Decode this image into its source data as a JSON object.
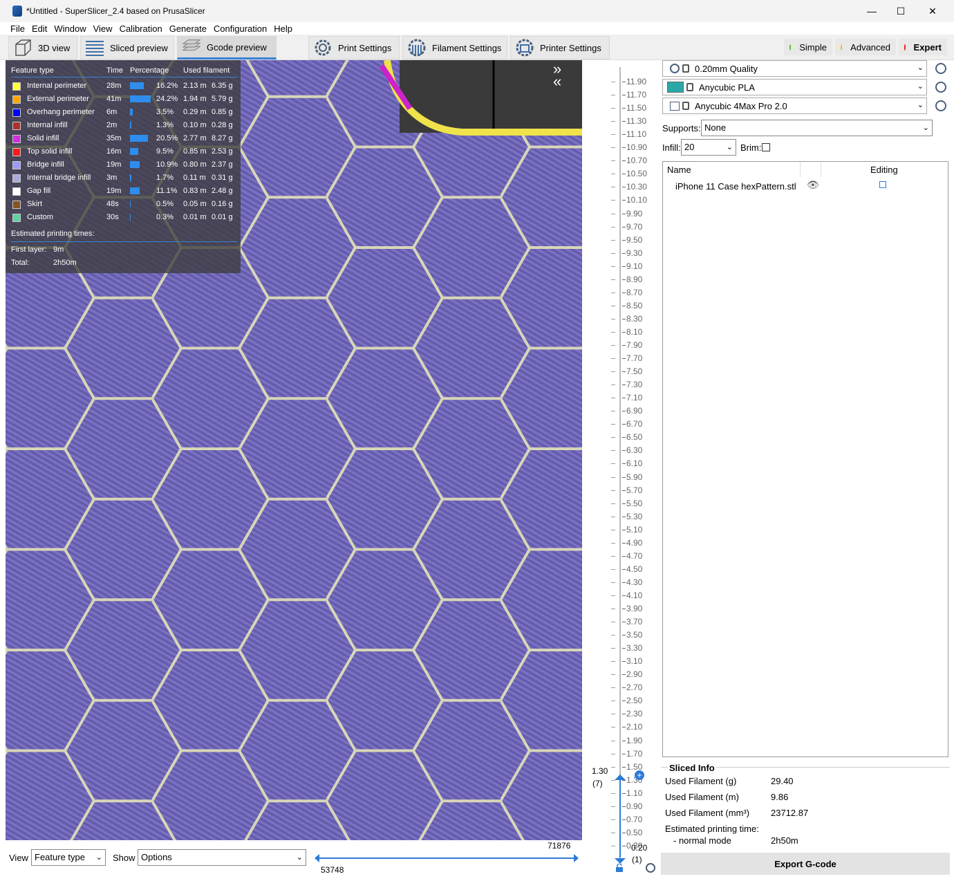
{
  "window": {
    "title": "*Untitled - SuperSlicer_2.4  based on PrusaSlicer"
  },
  "menu": [
    "File",
    "Edit",
    "Window",
    "View",
    "Calibration",
    "Generate",
    "Configuration",
    "Help"
  ],
  "tabs": {
    "view3d": "3D view",
    "sliced": "Sliced preview",
    "gcode": "Gcode preview",
    "print": "Print Settings",
    "filament": "Filament Settings",
    "printer": "Printer Settings"
  },
  "modes": {
    "simple": "Simple",
    "advanced": "Advanced",
    "expert": "Expert"
  },
  "mode_colors": {
    "simple": "#4ec42a",
    "advanced": "#f2c200",
    "expert": "#e02020"
  },
  "legend": {
    "headers": {
      "feature": "Feature type",
      "time": "Time",
      "pct": "Percentage",
      "used": "Used filament"
    },
    "rows": [
      {
        "name": "Internal perimeter",
        "color": "#ffff40",
        "time": "28m",
        "pct": "16.2%",
        "m": "2.13 m",
        "g": "6.35 g",
        "frac": 0.162
      },
      {
        "name": "External perimeter",
        "color": "#ffa500",
        "time": "41m",
        "pct": "24.2%",
        "m": "1.94 m",
        "g": "5.79 g",
        "frac": 0.242
      },
      {
        "name": "Overhang perimeter",
        "color": "#0000ff",
        "time": "6m",
        "pct": "3.5%",
        "m": "0.29 m",
        "g": "0.85 g",
        "frac": 0.035
      },
      {
        "name": "Internal infill",
        "color": "#b03029",
        "time": "2m",
        "pct": "1.3%",
        "m": "0.10 m",
        "g": "0.28 g",
        "frac": 0.013
      },
      {
        "name": "Solid infill",
        "color": "#d22de0",
        "time": "35m",
        "pct": "20.5%",
        "m": "2.77 m",
        "g": "8.27 g",
        "frac": 0.205
      },
      {
        "name": "Top solid infill",
        "color": "#ff1a1a",
        "time": "16m",
        "pct": "9.5%",
        "m": "0.85 m",
        "g": "2.53 g",
        "frac": 0.095
      },
      {
        "name": "Bridge infill",
        "color": "#9999ff",
        "time": "19m",
        "pct": "10.9%",
        "m": "0.80 m",
        "g": "2.37 g",
        "frac": 0.109
      },
      {
        "name": "Internal bridge infill",
        "color": "#aaaadd",
        "time": "3m",
        "pct": "1.7%",
        "m": "0.11 m",
        "g": "0.31 g",
        "frac": 0.017
      },
      {
        "name": "Gap fill",
        "color": "#ffffff",
        "time": "19m",
        "pct": "11.1%",
        "m": "0.83 m",
        "g": "2.48 g",
        "frac": 0.111
      },
      {
        "name": "Skirt",
        "color": "#845321",
        "time": "48s",
        "pct": "0.5%",
        "m": "0.05 m",
        "g": "0.16 g",
        "frac": 0.005
      },
      {
        "name": "Custom",
        "color": "#5ad3a0",
        "time": "30s",
        "pct": "0.3%",
        "m": "0.01 m",
        "g": "0.01 g",
        "frac": 0.003
      }
    ],
    "est_label": "Estimated printing times:",
    "first_layer_label": "First layer:",
    "first_layer": "9m",
    "total_label": "Total:",
    "total": "2h50m"
  },
  "ruler": {
    "labels": [
      "11.90",
      "11.70",
      "11.50",
      "11.30",
      "11.10",
      "10.90",
      "10.70",
      "10.50",
      "10.30",
      "10.10",
      "9.90",
      "9.70",
      "9.50",
      "9.30",
      "9.10",
      "8.90",
      "8.70",
      "8.50",
      "8.30",
      "8.10",
      "7.90",
      "7.70",
      "7.50",
      "7.30",
      "7.10",
      "6.90",
      "6.70",
      "6.50",
      "6.30",
      "6.10",
      "5.90",
      "5.70",
      "5.50",
      "5.30",
      "5.10",
      "4.90",
      "4.70",
      "4.50",
      "4.30",
      "4.10",
      "3.90",
      "3.70",
      "3.50",
      "3.30",
      "3.10",
      "2.90",
      "2.70",
      "2.50",
      "2.30",
      "2.10",
      "1.90",
      "1.70",
      "1.50",
      "1.30",
      "1.10",
      "0.90",
      "0.70",
      "0.50",
      "0.30"
    ],
    "upper_value": "1.30",
    "upper_layer": "(7)",
    "lower_value": "0.20",
    "lower_layer": "(1)"
  },
  "bottom": {
    "view_label": "View",
    "view_value": "Feature type",
    "show_label": "Show",
    "show_value": "Options",
    "h_right": "71876",
    "h_left": "53748"
  },
  "presets": {
    "print": "0.20mm Quality",
    "filament": "Anycubic PLA",
    "filament_color": "#2aa8a8",
    "printer": "Anycubic 4Max Pro 2.0"
  },
  "supports": {
    "label": "Supports:",
    "value": "None"
  },
  "infill": {
    "label": "Infill:",
    "value": "20"
  },
  "brim": {
    "label": "Brim:"
  },
  "objects": {
    "col_name": "Name",
    "col_editing": "Editing",
    "items": [
      {
        "name": "iPhone 11 Case hexPattern.stl"
      }
    ]
  },
  "sliced_info": {
    "title": "Sliced Info",
    "rows": [
      {
        "label": "Used Filament (g)",
        "value": "29.40"
      },
      {
        "label": "Used Filament (m)",
        "value": "9.86"
      },
      {
        "label": "Used Filament (mm³)",
        "value": "23712.87"
      }
    ],
    "est_label": "Estimated printing time:",
    "mode_label": "- normal mode",
    "mode_value": "2h50m"
  },
  "export_label": "Export G-code"
}
